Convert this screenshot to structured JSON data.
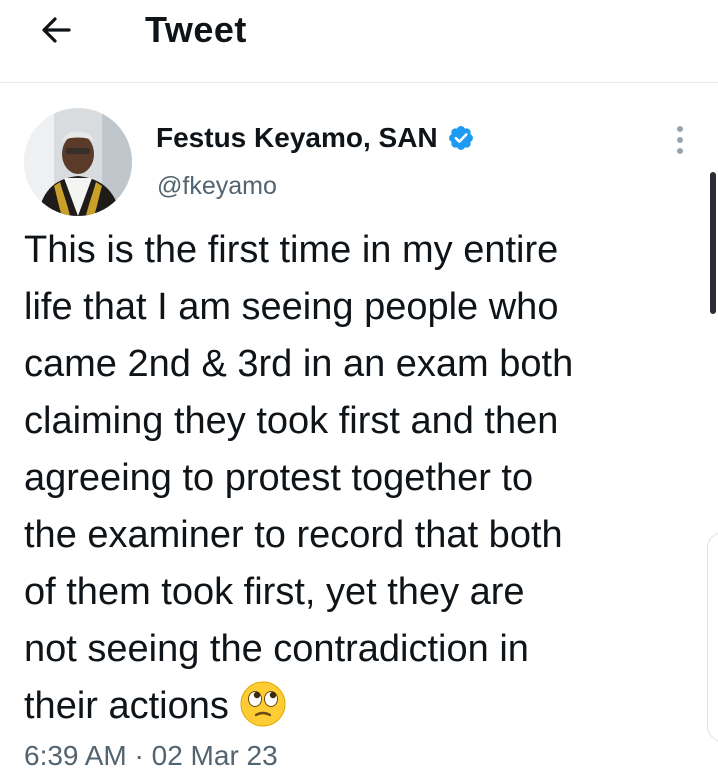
{
  "header": {
    "title": "Tweet",
    "back_icon": "arrow-left-icon"
  },
  "author": {
    "display_name": "Festus Keyamo, SAN",
    "handle": "@fkeyamo",
    "verified": true,
    "verified_color": "#1d9bf0"
  },
  "tweet": {
    "lines": [
      "This is the first time in my entire",
      "life that I am seeing people who",
      "came 2nd & 3rd in an exam both",
      "claiming they took first and then",
      "agreeing to protest together to",
      "the examiner to record that both",
      "of them took first, yet they are",
      "not seeing the contradiction in",
      "their actions"
    ],
    "emoji": "face-with-rolling-eyes"
  },
  "meta": {
    "time": "6:39 AM",
    "separator": "·",
    "date": "02 Mar 23"
  },
  "icons": {
    "more": "more-vertical-icon"
  }
}
